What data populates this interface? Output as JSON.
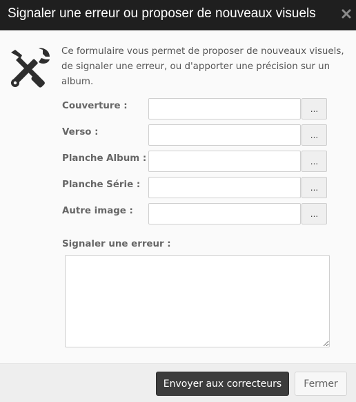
{
  "dialog": {
    "title": "Signaler une erreur ou proposer de nouveaux visuels",
    "close_icon": "close-icon",
    "tool_icon": "tools-icon",
    "intro": "Ce formulaire vous permet de proposer de nouveaux visuels, de signaler une erreur, ou d'apporter une précision sur un album."
  },
  "fields": [
    {
      "label": "Couverture :",
      "value": "",
      "button": "..."
    },
    {
      "label": "Verso :",
      "value": "",
      "button": "..."
    },
    {
      "label": "Planche Album :",
      "value": "",
      "button": "..."
    },
    {
      "label": "Planche Série :",
      "value": "",
      "button": "..."
    },
    {
      "label": "Autre image :",
      "value": "",
      "button": "..."
    }
  ],
  "error": {
    "label": "Signaler une erreur :",
    "value": ""
  },
  "footer": {
    "submit_label": "Envoyer aux correcteurs",
    "cancel_label": "Fermer"
  },
  "colors": {
    "titlebar": "#1f1f1f",
    "primary_button": "#3c3c3c",
    "footer": "#eeeeee"
  }
}
